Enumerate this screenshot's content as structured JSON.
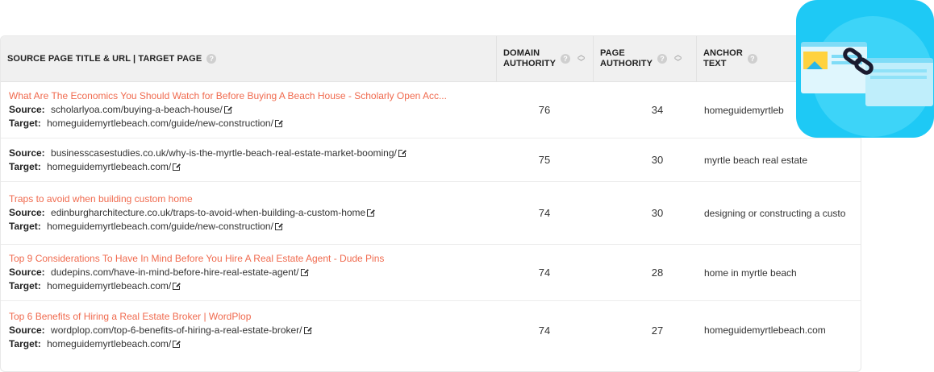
{
  "header": {
    "source": "SOURCE PAGE TITLE & URL | TARGET PAGE",
    "da_line1": "DOMAIN",
    "da_line2": "AUTHORITY",
    "pa_line1": "PAGE",
    "pa_line2": "AUTHORITY",
    "anchor_line1": "ANCHOR",
    "anchor_line2": "TEXT"
  },
  "labels": {
    "source": "Source:",
    "target": "Target:"
  },
  "rows": [
    {
      "title": "What Are The Economics You Should Watch for Before Buying A Beach House - Scholarly Open Acc...",
      "source": "scholarlyoa.com/buying-a-beach-house/",
      "target": "homeguidemyrtlebeach.com/guide/new-construction/",
      "da": "76",
      "pa": "34",
      "anchor": "homeguidemyrtleb"
    },
    {
      "title": "",
      "source": "businesscasestudies.co.uk/why-is-the-myrtle-beach-real-estate-market-booming/",
      "target": "homeguidemyrtlebeach.com/",
      "da": "75",
      "pa": "30",
      "anchor": "myrtle beach real estate"
    },
    {
      "title": "Traps to avoid when building custom home",
      "source": "edinburgharchitecture.co.uk/traps-to-avoid-when-building-a-custom-home",
      "target": "homeguidemyrtlebeach.com/guide/new-construction/",
      "da": "74",
      "pa": "30",
      "anchor": "designing or constructing a custo"
    },
    {
      "title": "Top 9 Considerations To Have In Mind Before You Hire A Real Estate Agent - Dude Pins",
      "source": "dudepins.com/have-in-mind-before-hire-real-estate-agent/",
      "target": "homeguidemyrtlebeach.com/",
      "da": "74",
      "pa": "28",
      "anchor": "home in myrtle beach"
    },
    {
      "title": "Top 6 Benefits of Hiring a Real Estate Broker | WordPlop",
      "source": "wordplop.com/top-6-benefits-of-hiring-a-real-estate-broker/",
      "target": "homeguidemyrtlebeach.com/",
      "da": "74",
      "pa": "27",
      "anchor": "homeguidemyrtlebeach.com"
    }
  ],
  "colors": {
    "title_link": "#f06a4e",
    "header_bg": "#f0f0f0",
    "app_icon_bg": "#1ec9f5"
  },
  "icons": {
    "help": "help-circle-icon",
    "sort": "sort-arrows-icon",
    "external": "external-link-icon",
    "app": "backlinks-app-icon"
  }
}
